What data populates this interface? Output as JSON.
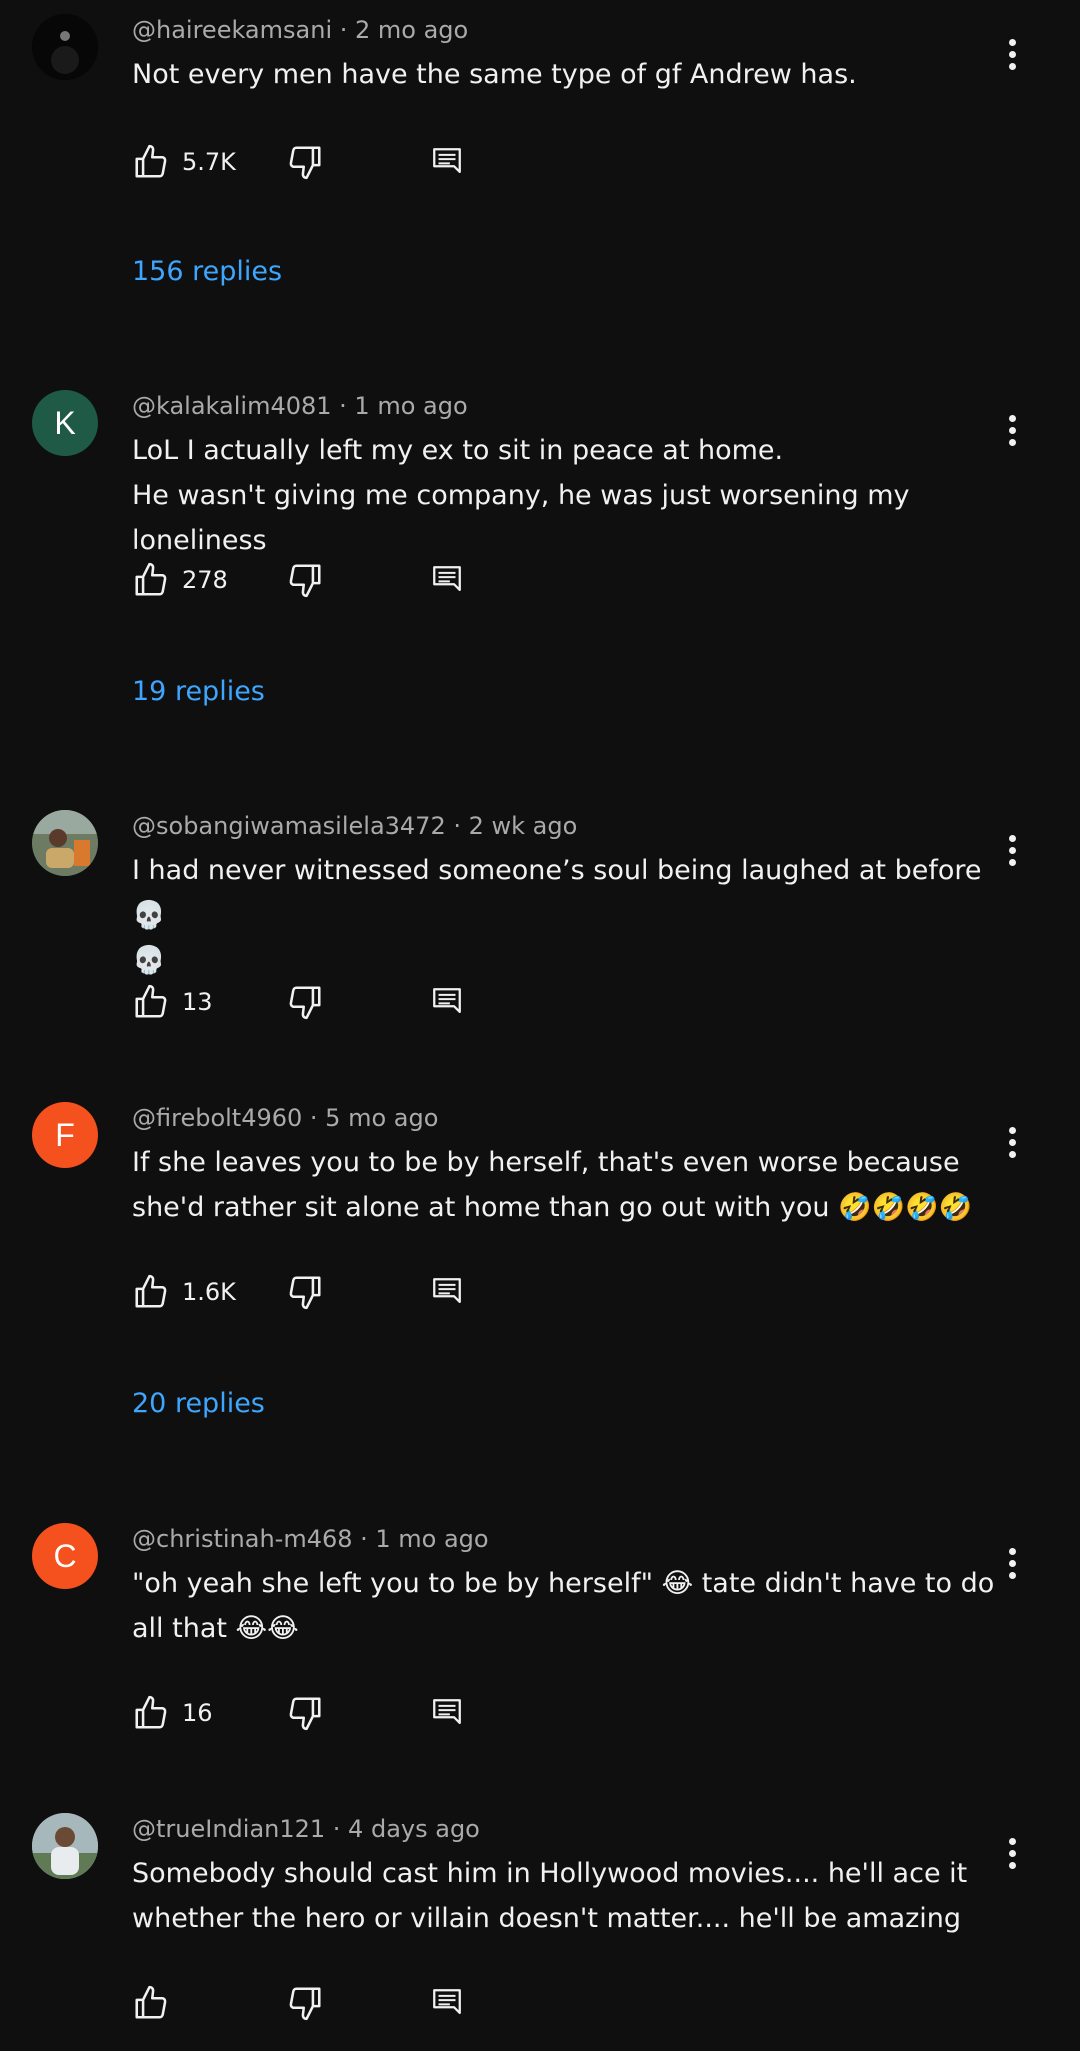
{
  "colors": {
    "background": "#0f0f0f",
    "text": "#f1f1f1",
    "meta": "#aaaaaa",
    "link": "#3ea6ff",
    "avatar_k": "#1f5a46",
    "avatar_f": "#f4511e",
    "avatar_c": "#f4511e"
  },
  "comments": [
    {
      "avatar": {
        "type": "image",
        "icon": "profile-photo-dark"
      },
      "meta": "@haireekamsani · 2 mo ago",
      "lines": [
        "Not every men have the same type of gf Andrew has."
      ],
      "likes": "5.7K",
      "replies": "156 replies"
    },
    {
      "avatar": {
        "type": "letter",
        "letter": "K"
      },
      "meta": "@kalakalim4081 · 1 mo ago",
      "lines": [
        "LoL I actually left my ex to sit in peace at home.",
        "He wasn't giving me company, he was just worsening my loneliness"
      ],
      "likes": "278",
      "replies": "19 replies"
    },
    {
      "avatar": {
        "type": "image",
        "icon": "profile-photo-outdoor"
      },
      "meta": "@sobangiwamasilela3472 · 2 wk ago",
      "lines": [
        "I had never witnessed someone’s soul being laughed at before 💀",
        "💀"
      ],
      "likes": "13",
      "replies": ""
    },
    {
      "avatar": {
        "type": "letter",
        "letter": "F"
      },
      "meta": "@firebolt4960 · 5 mo ago",
      "lines": [
        "If she leaves you to be by herself, that's even worse because",
        "she'd rather sit alone at home than go out with you 🤣🤣🤣🤣"
      ],
      "likes": "1.6K",
      "replies": "20 replies"
    },
    {
      "avatar": {
        "type": "letter",
        "letter": "C"
      },
      "meta": "@christinah-m468 · 1 mo ago",
      "lines": [
        "\"oh yeah she left you to be by herself\" 😂 tate didn't have to do",
        "all that 😂😂"
      ],
      "likes": "16",
      "replies": ""
    },
    {
      "avatar": {
        "type": "image",
        "icon": "profile-photo-person"
      },
      "meta": "@trueIndian121 · 4 days ago",
      "lines": [
        "Somebody should cast him in Hollywood movies.... he'll ace it",
        "whether the hero or villain doesn't matter.... he'll be amazing"
      ],
      "likes": "",
      "replies": ""
    }
  ]
}
